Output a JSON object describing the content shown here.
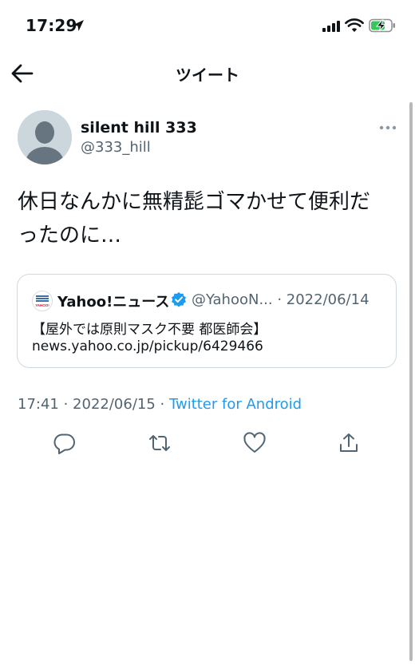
{
  "status_bar": {
    "time": "17:29",
    "icons": [
      "location-arrow-icon",
      "signal-icon",
      "wifi-icon",
      "battery-charging-icon"
    ]
  },
  "nav": {
    "title": "ツイート",
    "back_icon": "back-arrow-icon"
  },
  "tweet": {
    "display_name": "silent hill 333",
    "handle": "@333_hill",
    "text_line1": "休日なんかに無精髭ゴマかせて便利だ",
    "text_line2": "ったのに…",
    "timestamp": "17:41 · 2022/06/15 · ",
    "source": "Twitter for Android"
  },
  "quote": {
    "name": "Yahoo!ニュース",
    "handle_date": "@YahooN... · 2022/06/14",
    "line1": "【屋外では原則マスク不要 都医師会】",
    "line2": "news.yahoo.co.jp/pickup/6429466",
    "logo_text": "YAHOO!"
  },
  "actions": [
    "reply-icon",
    "retweet-icon",
    "like-icon",
    "share-icon"
  ],
  "colors": {
    "accent": "#1d9bf0",
    "secondary_text": "#536471",
    "border": "#cfd9de",
    "battery_green": "#34c759"
  }
}
